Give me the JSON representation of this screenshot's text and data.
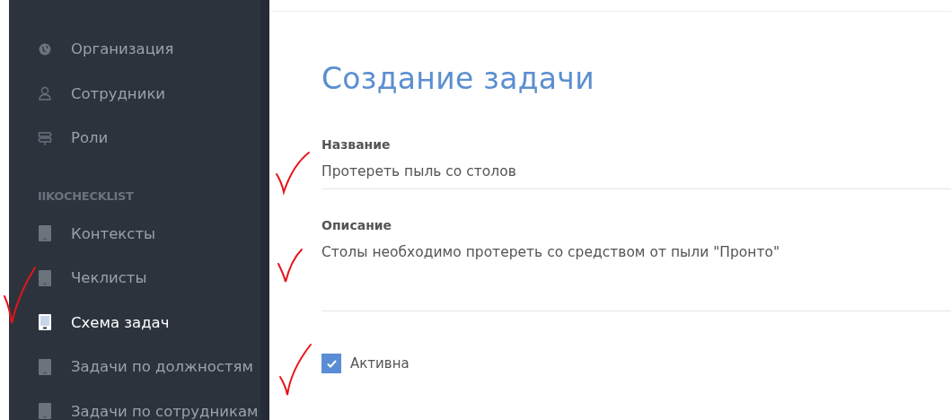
{
  "sidebar": {
    "items": [
      {
        "label": "Организация",
        "selected": false
      },
      {
        "label": "Сотрудники",
        "selected": false
      },
      {
        "label": "Роли",
        "selected": false
      }
    ],
    "section": {
      "title": "IIKOCHECKLIST",
      "items": [
        {
          "label": "Контексты",
          "selected": false
        },
        {
          "label": "Чеклисты",
          "selected": false
        },
        {
          "label": "Схема задач",
          "selected": true
        },
        {
          "label": "Задачи по должностям",
          "selected": false
        },
        {
          "label": "Задачи по сотрудникам",
          "selected": false
        }
      ]
    }
  },
  "form": {
    "title": "Создание задачи",
    "fields": [
      {
        "label": "Название",
        "value": "Протереть пыль со столов"
      },
      {
        "label": "Описание",
        "value": "Столы необходимо протереть со средством от пыли \"Пронто\""
      }
    ],
    "checkbox": {
      "label": "Активна",
      "checked": true
    }
  }
}
